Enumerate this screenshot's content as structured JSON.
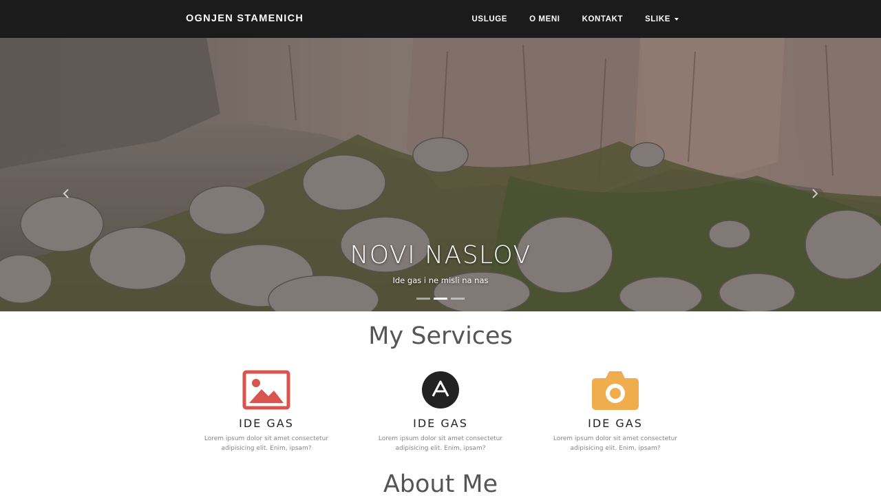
{
  "navbar": {
    "brand": "OGNJEN STAMENICH",
    "links": [
      {
        "label": "USLUGE"
      },
      {
        "label": "O MENI"
      },
      {
        "label": "KONTAKT"
      },
      {
        "label": "SLIKE",
        "dropdown": true
      }
    ]
  },
  "hero": {
    "title": "NOVI NASLOV",
    "subtitle": "Ide gas i ne misli na nas",
    "indicator_count": 3,
    "active_indicator": 1,
    "prev_icon": "chevron-left-icon",
    "next_icon": "chevron-right-icon"
  },
  "services": {
    "title": "My Services",
    "items": [
      {
        "icon": "image-icon",
        "color": "#d9534f",
        "heading": "IDE GAS",
        "text": "Lorem ipsum dolor sit amet consectetur adipisicing elit. Enim, ipsam?"
      },
      {
        "icon": "app-logo-icon",
        "color": "#222222",
        "heading": "IDE GAS",
        "text": "Lorem ipsum dolor sit amet consectetur adipisicing elit. Enim, ipsam?"
      },
      {
        "icon": "camera-icon",
        "color": "#f0ad4e",
        "heading": "IDE GAS",
        "text": "Lorem ipsum dolor sit amet consectetur adipisicing elit. Enim, ipsam?"
      }
    ]
  },
  "about": {
    "title": "About Me"
  }
}
